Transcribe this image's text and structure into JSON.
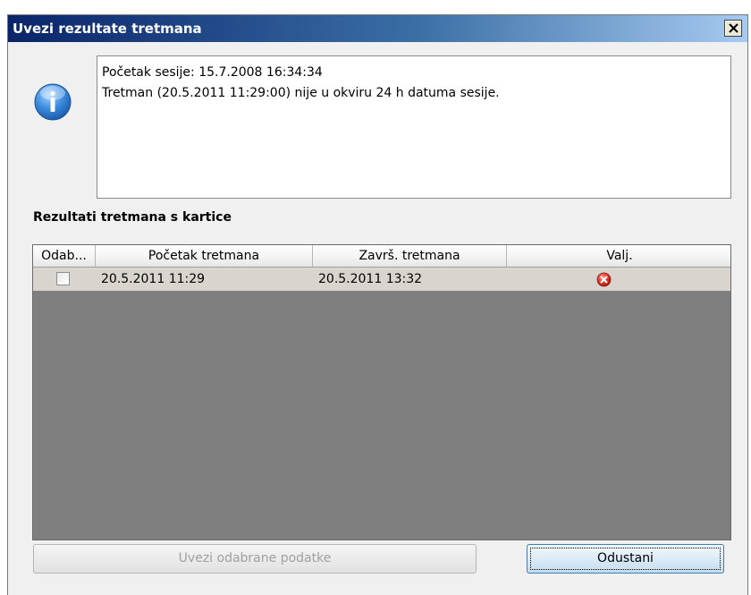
{
  "window": {
    "title": "Uvezi rezultate tretmana",
    "close_label": "×"
  },
  "message": {
    "line1": "Početak sesije: 15.7.2008 16:34:34",
    "line2": "Tretman (20.5.2011 11:29:00) nije u okviru 24 h datuma sesije."
  },
  "section_title": "Rezultati tretmana s kartice",
  "grid": {
    "columns": [
      "Odab...",
      "Početak tretmana",
      "Završ. tretmana",
      "Valj."
    ],
    "rows": [
      {
        "selected": false,
        "start": "20.5.2011 11:29",
        "end": "20.5.2011 13:32",
        "valid_icon": "error-icon"
      }
    ]
  },
  "buttons": {
    "import_selected": "Uvezi odabrane podatke",
    "cancel": "Odustani"
  },
  "colors": {
    "title_gradient_start": "#0a246a",
    "title_gradient_end": "#a6caf0",
    "grid_background": "#7f7f7f",
    "row_background": "#d9d4cd",
    "error_red": "#e0342a"
  }
}
